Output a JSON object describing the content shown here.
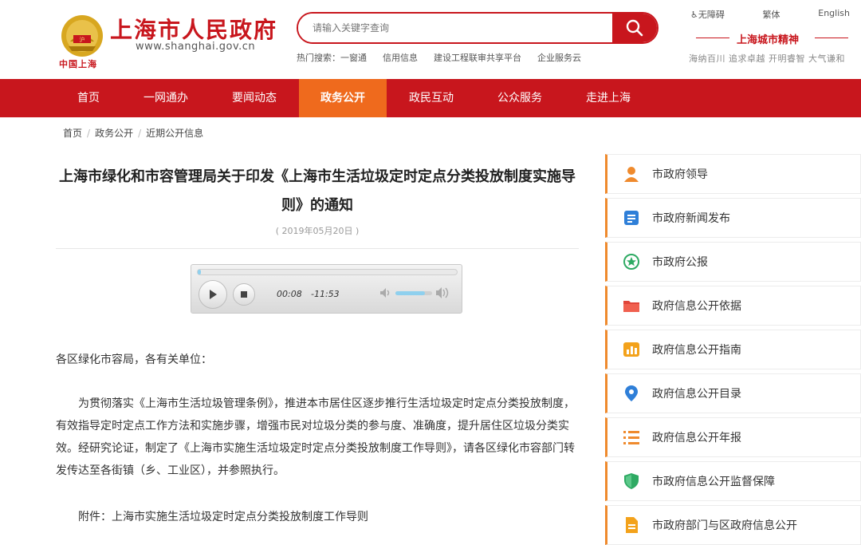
{
  "header": {
    "logo_caption": "中国上海",
    "site_title": "上海市人民政府",
    "site_url": "www.shanghai.gov.cn",
    "search_placeholder": "请输入关键字查询",
    "hot_search_label": "热门搜索：",
    "hot_search": [
      "一窗通",
      "信用信息",
      "建设工程联审共享平台",
      "企业服务云"
    ],
    "top_links": [
      "无障碍",
      "繁体",
      "English"
    ],
    "spirit_title": "上海城市精神",
    "spirit_text": "海纳百川 追求卓越 开明睿智 大气谦和"
  },
  "nav": {
    "items": [
      "首页",
      "一网通办",
      "要闻动态",
      "政务公开",
      "政民互动",
      "公众服务",
      "走进上海"
    ],
    "active_index": 3
  },
  "breadcrumb": [
    "首页",
    "政务公开",
    "近期公开信息"
  ],
  "article": {
    "title": "上海市绿化和市容管理局关于印发《上海市生活垃圾定时定点分类投放制度实施导则》的通知",
    "date": "( 2019年05月20日 )",
    "player": {
      "current_time": "00:08",
      "remaining_time": "-11:53",
      "progress_fraction": 0.012,
      "volume_fraction": 0.8
    },
    "paragraphs": [
      "各区绿化市容局，各有关单位：",
      "为贯彻落实《上海市生活垃圾管理条例》，推进本市居住区逐步推行生活垃圾定时定点分类投放制度，有效指导定时定点工作方法和实施步骤，增强市民对垃圾分类的参与度、准确度，提升居住区垃圾分类实效。经研究论证，制定了《上海市实施生活垃圾定时定点分类投放制度工作导则》，请各区绿化市容部门转发传达至各街镇（乡、工业区），并参照执行。",
      "附件：上海市实施生活垃圾定时定点分类投放制度工作导则"
    ]
  },
  "sidebar": {
    "items": [
      {
        "label": "市政府领导",
        "icon": "person-icon",
        "color": "#ef8a2d"
      },
      {
        "label": "市政府新闻发布",
        "icon": "document-icon",
        "color": "#2f7fd8"
      },
      {
        "label": "市政府公报",
        "icon": "star-badge-icon",
        "color": "#2eaa63"
      },
      {
        "label": "政府信息公开依据",
        "icon": "folder-icon",
        "color": "#e0453a"
      },
      {
        "label": "政府信息公开指南",
        "icon": "chart-icon",
        "color": "#f3a21b"
      },
      {
        "label": "政府信息公开目录",
        "icon": "location-pin-icon",
        "color": "#2f7fd8"
      },
      {
        "label": "政府信息公开年报",
        "icon": "list-icon",
        "color": "#ef8a2d"
      },
      {
        "label": "市政府信息公开监督保障",
        "icon": "shield-icon",
        "color": "#2eaa63"
      },
      {
        "label": "市政府部门与区政府信息公开",
        "icon": "file-icon",
        "color": "#f3a21b"
      }
    ]
  },
  "colors": {
    "brand_red": "#c8161d",
    "nav_active": "#ef6a1d",
    "sidebar_accent": "#ef8a2d"
  }
}
